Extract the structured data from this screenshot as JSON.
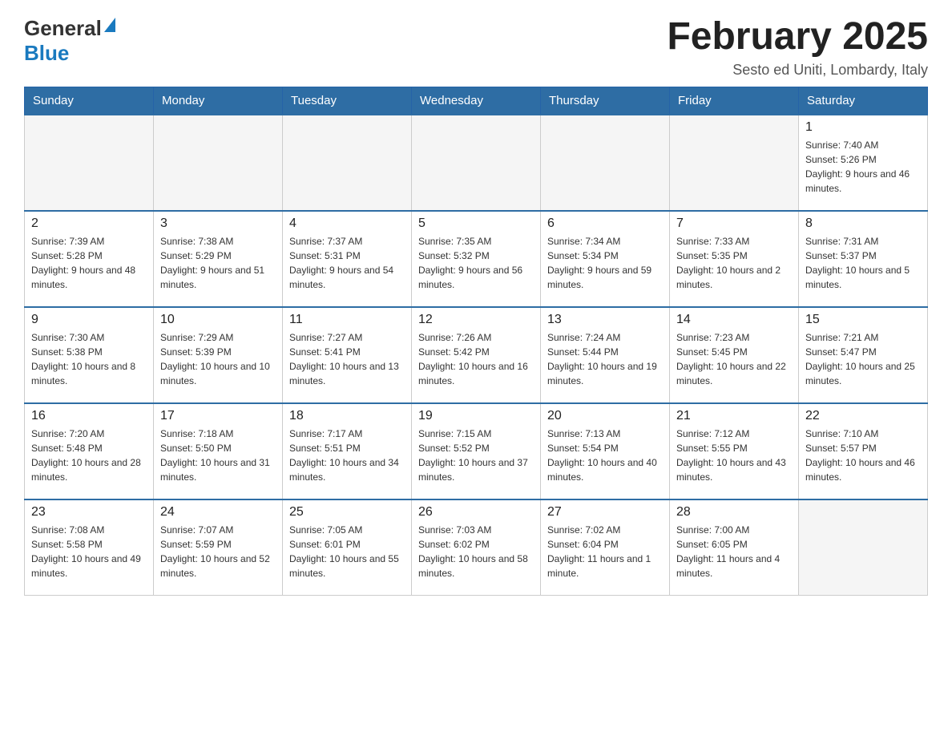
{
  "logo": {
    "general": "General",
    "blue": "Blue"
  },
  "title": "February 2025",
  "subtitle": "Sesto ed Uniti, Lombardy, Italy",
  "days_of_week": [
    "Sunday",
    "Monday",
    "Tuesday",
    "Wednesday",
    "Thursday",
    "Friday",
    "Saturday"
  ],
  "weeks": [
    [
      {
        "day": "",
        "info": ""
      },
      {
        "day": "",
        "info": ""
      },
      {
        "day": "",
        "info": ""
      },
      {
        "day": "",
        "info": ""
      },
      {
        "day": "",
        "info": ""
      },
      {
        "day": "",
        "info": ""
      },
      {
        "day": "1",
        "info": "Sunrise: 7:40 AM\nSunset: 5:26 PM\nDaylight: 9 hours and 46 minutes."
      }
    ],
    [
      {
        "day": "2",
        "info": "Sunrise: 7:39 AM\nSunset: 5:28 PM\nDaylight: 9 hours and 48 minutes."
      },
      {
        "day": "3",
        "info": "Sunrise: 7:38 AM\nSunset: 5:29 PM\nDaylight: 9 hours and 51 minutes."
      },
      {
        "day": "4",
        "info": "Sunrise: 7:37 AM\nSunset: 5:31 PM\nDaylight: 9 hours and 54 minutes."
      },
      {
        "day": "5",
        "info": "Sunrise: 7:35 AM\nSunset: 5:32 PM\nDaylight: 9 hours and 56 minutes."
      },
      {
        "day": "6",
        "info": "Sunrise: 7:34 AM\nSunset: 5:34 PM\nDaylight: 9 hours and 59 minutes."
      },
      {
        "day": "7",
        "info": "Sunrise: 7:33 AM\nSunset: 5:35 PM\nDaylight: 10 hours and 2 minutes."
      },
      {
        "day": "8",
        "info": "Sunrise: 7:31 AM\nSunset: 5:37 PM\nDaylight: 10 hours and 5 minutes."
      }
    ],
    [
      {
        "day": "9",
        "info": "Sunrise: 7:30 AM\nSunset: 5:38 PM\nDaylight: 10 hours and 8 minutes."
      },
      {
        "day": "10",
        "info": "Sunrise: 7:29 AM\nSunset: 5:39 PM\nDaylight: 10 hours and 10 minutes."
      },
      {
        "day": "11",
        "info": "Sunrise: 7:27 AM\nSunset: 5:41 PM\nDaylight: 10 hours and 13 minutes."
      },
      {
        "day": "12",
        "info": "Sunrise: 7:26 AM\nSunset: 5:42 PM\nDaylight: 10 hours and 16 minutes."
      },
      {
        "day": "13",
        "info": "Sunrise: 7:24 AM\nSunset: 5:44 PM\nDaylight: 10 hours and 19 minutes."
      },
      {
        "day": "14",
        "info": "Sunrise: 7:23 AM\nSunset: 5:45 PM\nDaylight: 10 hours and 22 minutes."
      },
      {
        "day": "15",
        "info": "Sunrise: 7:21 AM\nSunset: 5:47 PM\nDaylight: 10 hours and 25 minutes."
      }
    ],
    [
      {
        "day": "16",
        "info": "Sunrise: 7:20 AM\nSunset: 5:48 PM\nDaylight: 10 hours and 28 minutes."
      },
      {
        "day": "17",
        "info": "Sunrise: 7:18 AM\nSunset: 5:50 PM\nDaylight: 10 hours and 31 minutes."
      },
      {
        "day": "18",
        "info": "Sunrise: 7:17 AM\nSunset: 5:51 PM\nDaylight: 10 hours and 34 minutes."
      },
      {
        "day": "19",
        "info": "Sunrise: 7:15 AM\nSunset: 5:52 PM\nDaylight: 10 hours and 37 minutes."
      },
      {
        "day": "20",
        "info": "Sunrise: 7:13 AM\nSunset: 5:54 PM\nDaylight: 10 hours and 40 minutes."
      },
      {
        "day": "21",
        "info": "Sunrise: 7:12 AM\nSunset: 5:55 PM\nDaylight: 10 hours and 43 minutes."
      },
      {
        "day": "22",
        "info": "Sunrise: 7:10 AM\nSunset: 5:57 PM\nDaylight: 10 hours and 46 minutes."
      }
    ],
    [
      {
        "day": "23",
        "info": "Sunrise: 7:08 AM\nSunset: 5:58 PM\nDaylight: 10 hours and 49 minutes."
      },
      {
        "day": "24",
        "info": "Sunrise: 7:07 AM\nSunset: 5:59 PM\nDaylight: 10 hours and 52 minutes."
      },
      {
        "day": "25",
        "info": "Sunrise: 7:05 AM\nSunset: 6:01 PM\nDaylight: 10 hours and 55 minutes."
      },
      {
        "day": "26",
        "info": "Sunrise: 7:03 AM\nSunset: 6:02 PM\nDaylight: 10 hours and 58 minutes."
      },
      {
        "day": "27",
        "info": "Sunrise: 7:02 AM\nSunset: 6:04 PM\nDaylight: 11 hours and 1 minute."
      },
      {
        "day": "28",
        "info": "Sunrise: 7:00 AM\nSunset: 6:05 PM\nDaylight: 11 hours and 4 minutes."
      },
      {
        "day": "",
        "info": ""
      }
    ]
  ]
}
